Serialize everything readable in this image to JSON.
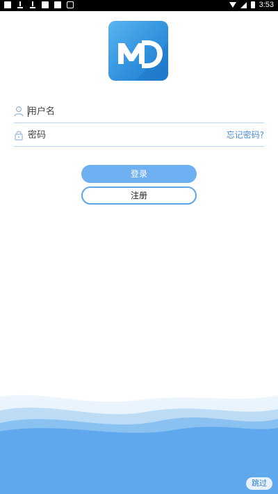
{
  "status_bar": {
    "time": "3:53"
  },
  "logo": {
    "letters": "MD"
  },
  "login_form": {
    "username_placeholder": "用户名",
    "password_placeholder": "密码",
    "forgot_password_link": "忘记密码?",
    "login_button": "登录",
    "register_button": "注册"
  },
  "skip_button": "跳过",
  "colors": {
    "accent": "#6fb0f2",
    "link": "#4a8ed6",
    "wave": "#5fa8ee"
  }
}
